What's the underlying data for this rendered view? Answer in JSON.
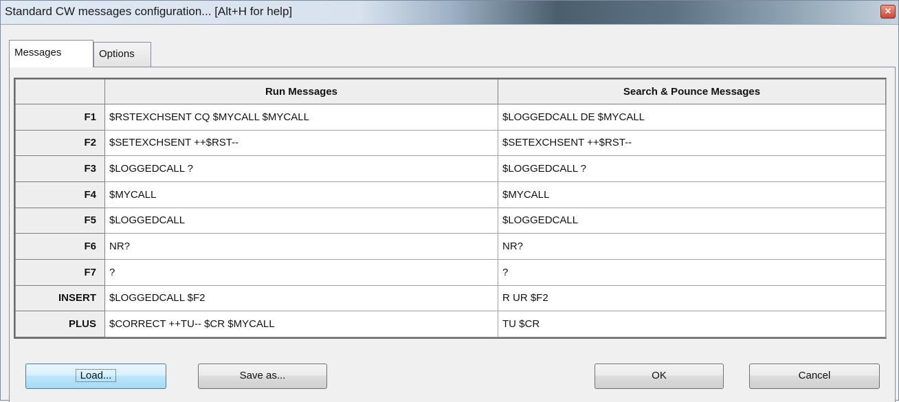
{
  "window": {
    "title": "Standard CW messages configuration... [Alt+H for help]",
    "close_glyph": "×"
  },
  "tabs": [
    {
      "label": "Messages",
      "active": true
    },
    {
      "label": "Options",
      "active": false
    }
  ],
  "table": {
    "columns": [
      "",
      "Run Messages",
      "Search & Pounce Messages"
    ],
    "rows": [
      {
        "key": "F1",
        "run": "$RSTEXCHSENT CQ $MYCALL $MYCALL",
        "sp": "$LOGGEDCALL DE $MYCALL"
      },
      {
        "key": "F2",
        "run": "$SETEXCHSENT ++$RST--",
        "sp": "$SETEXCHSENT ++$RST--"
      },
      {
        "key": "F3",
        "run": "$LOGGEDCALL ?",
        "sp": "$LOGGEDCALL ?"
      },
      {
        "key": "F4",
        "run": "$MYCALL",
        "sp": "$MYCALL"
      },
      {
        "key": "F5",
        "run": "$LOGGEDCALL",
        "sp": "$LOGGEDCALL"
      },
      {
        "key": "F6",
        "run": "NR?",
        "sp": "NR?"
      },
      {
        "key": "F7",
        "run": "?",
        "sp": "?"
      },
      {
        "key": "INSERT",
        "run": "$LOGGEDCALL $F2",
        "sp": "R UR $F2"
      },
      {
        "key": "PLUS",
        "run": "$CORRECT ++TU-- $CR $MYCALL",
        "sp": "TU $CR"
      }
    ]
  },
  "buttons": {
    "load": "Load...",
    "save_as": "Save as...",
    "ok": "OK",
    "cancel": "Cancel"
  }
}
